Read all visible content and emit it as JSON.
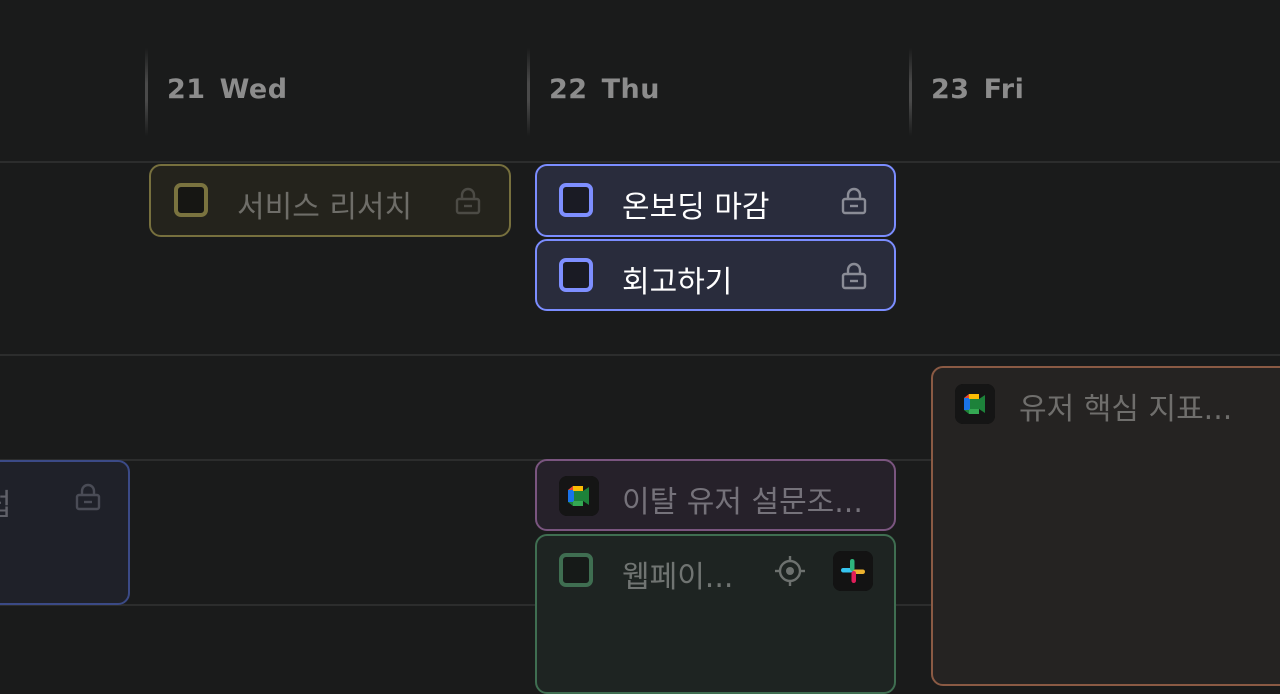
{
  "days": [
    {
      "num": "21",
      "name": "Wed"
    },
    {
      "num": "22",
      "name": "Thu"
    },
    {
      "num": "23",
      "name": "Fri"
    }
  ],
  "events": {
    "service_research": {
      "title": "서비스 리서치"
    },
    "onboarding_deadline": {
      "title": "온보딩 마감"
    },
    "retrospective": {
      "title": "회고하기"
    },
    "user_metrics": {
      "title": "유저 핵심 지표..."
    },
    "partial_left": {
      "title": "럽"
    },
    "churn_survey": {
      "title": "이탈 유저 설문조..."
    },
    "webpage": {
      "title": "웹페이..."
    }
  },
  "colors": {
    "background": "#1a1b1b",
    "olive": "#77703e",
    "blue": "#7b8dff",
    "purple": "#7a557f",
    "green": "#3f6e51",
    "orange": "#8a5a44"
  },
  "icons": [
    "checkbox-icon",
    "lock-icon",
    "google-meet-icon",
    "target-icon",
    "slack-icon"
  ]
}
